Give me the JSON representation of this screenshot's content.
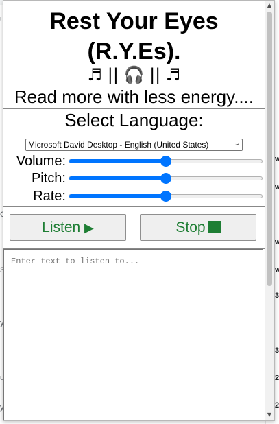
{
  "app": {
    "title_line1": "Rest Your Eyes",
    "title_line2": "(R.Y.Es).",
    "icons_line": "♬ || 🎧 || ♬",
    "tagline": "Read more with less energy...."
  },
  "language": {
    "label": "Select Language:",
    "selected_voice": "Microsoft David Desktop - English (United States)"
  },
  "sliders": [
    {
      "label": "Volume:",
      "value": 0.5
    },
    {
      "label": "Pitch:",
      "value": 0.5
    },
    {
      "label": "Rate:",
      "value": 0.5
    }
  ],
  "buttons": {
    "listen_label": "Listen",
    "stop_label": "Stop"
  },
  "textarea": {
    "placeholder": "Enter text to listen to...",
    "value": ""
  },
  "colors": {
    "accent": "#0075ff",
    "button_text": "#1e7e34"
  },
  "background_page": {
    "right_glyphs": [
      "w",
      "w",
      "w",
      "w",
      "3",
      "3",
      "2",
      "2"
    ],
    "left_glyphs": [
      "u",
      "3",
      "C",
      "y",
      "u",
      "y"
    ]
  }
}
